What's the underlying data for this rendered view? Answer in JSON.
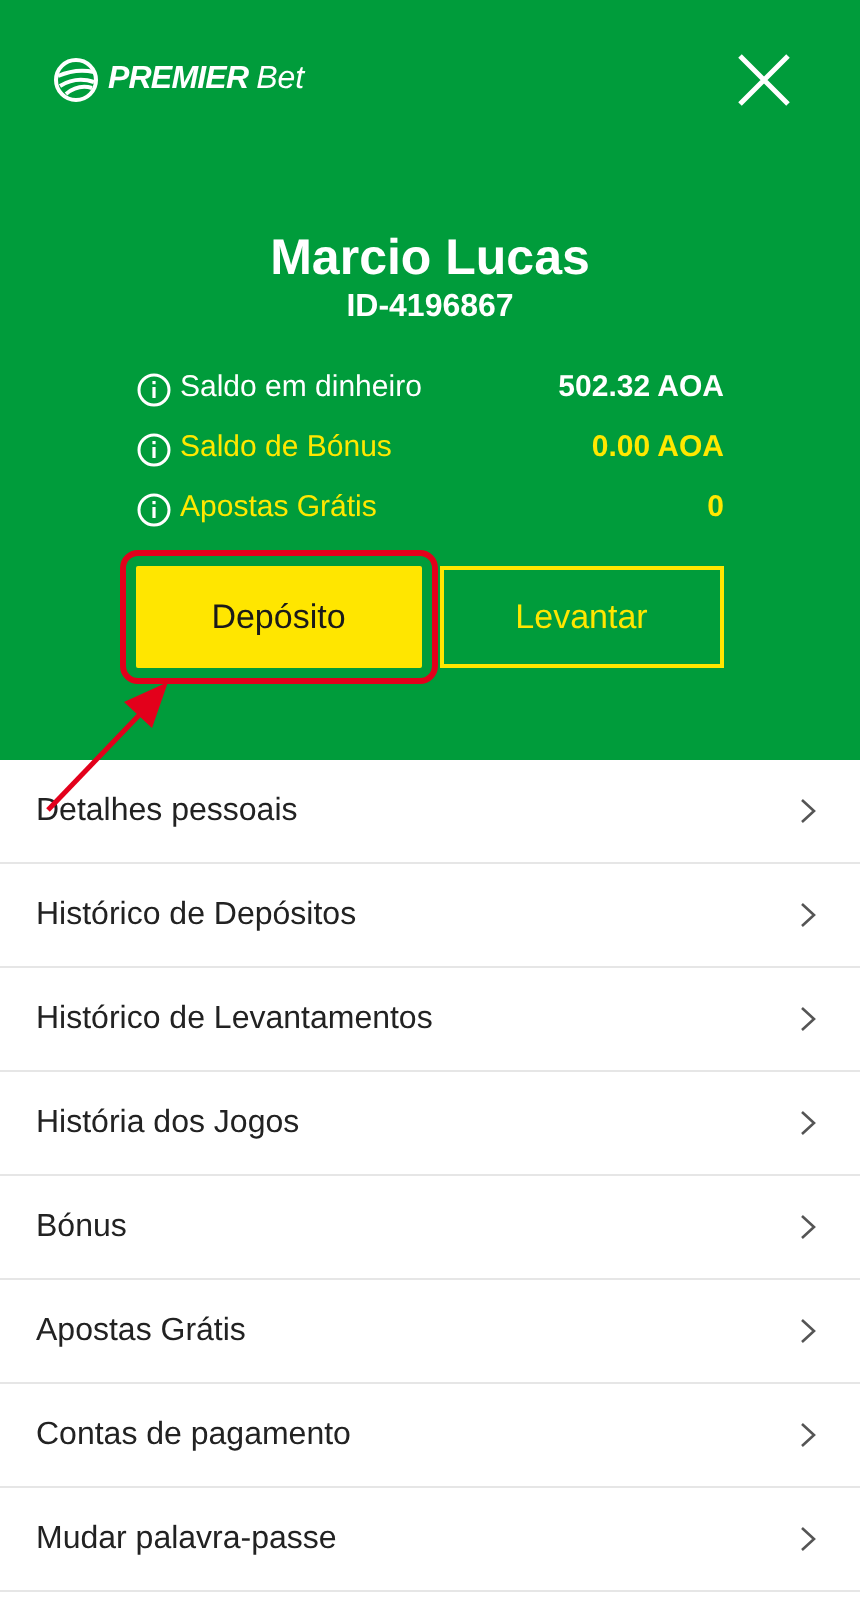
{
  "header": {
    "logo": {
      "brand": "PREMIER",
      "suffix": "Bet"
    },
    "name": "Marcio Lucas",
    "id": "ID-4196867"
  },
  "balances": [
    {
      "label": "Saldo em dinheiro",
      "value": "502.32 AOA",
      "color": "#ffffff"
    },
    {
      "label": "Saldo de Bónus",
      "value": "0.00 AOA",
      "color": "#ffe800"
    },
    {
      "label": "Apostas Grátis",
      "value": "0",
      "color": "#ffe800"
    }
  ],
  "buttons": [
    {
      "label": "Depósito",
      "kind": "filled",
      "highlighted": true
    },
    {
      "label": "Levantar",
      "kind": "outline",
      "highlighted": false
    }
  ],
  "menu": [
    {
      "label": "Detalhes pessoais"
    },
    {
      "label": "Histórico de Depósitos"
    },
    {
      "label": "Histórico de Levantamentos"
    },
    {
      "label": "História dos Jogos"
    },
    {
      "label": "Bónus"
    },
    {
      "label": "Apostas Grátis"
    },
    {
      "label": "Contas de pagamento"
    },
    {
      "label": "Mudar palavra-passe"
    }
  ]
}
